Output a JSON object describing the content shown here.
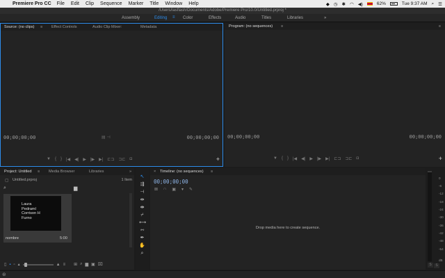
{
  "menubar": {
    "app_name": "Premiere Pro CC",
    "items": [
      "File",
      "Edit",
      "Clip",
      "Sequence",
      "Marker",
      "Title",
      "Window",
      "Help"
    ],
    "battery": "62%",
    "clock": "Tue 9:37 AM"
  },
  "titlebar": {
    "path": "/Users/lasflash/Documents/Adobe/Premiere Pro/10.0/Untitled.prproj *"
  },
  "workspaces": {
    "items": [
      "Assembly",
      "Editing",
      "Color",
      "Effects",
      "Audio",
      "Titles",
      "Libraries"
    ],
    "active": "Editing",
    "overflow": "»"
  },
  "source_panel": {
    "tabs": [
      "Source: (no clips)",
      "Effect Controls",
      "Audio Clip Mixer:",
      "Metadata"
    ],
    "tab_menu": "≡",
    "timecode_left": "00;00;00;00",
    "timecode_right": "00;00;00;00",
    "add_button": "+"
  },
  "program_panel": {
    "tab": "Program: (no sequences)",
    "tab_menu": "≡",
    "menu_icon": "≡",
    "timecode_left": "00;00;00;00",
    "timecode_right": "00;00;00;00",
    "add_button": "+"
  },
  "project_panel": {
    "tabs": [
      "Project: Untitled",
      "Media Browser",
      "Libraries"
    ],
    "tab_menu": "≡",
    "overflow": "»",
    "file_name": "Untitled.prproj",
    "item_count": "1 Item",
    "clip": {
      "thumb_lines": [
        "Laura",
        "Pedraml",
        "Corrison H",
        "Furno"
      ],
      "name": "nombre",
      "duration": "5:00"
    }
  },
  "timeline_panel": {
    "tab": "Timeline: (no sequences)",
    "close": "×",
    "tab_menu": "≡",
    "timecode": "00;00;00;00",
    "empty_message": "Drop media here to create sequence."
  },
  "audio_meter": {
    "scale": [
      "0",
      "-6",
      "-12",
      "-18",
      "-24",
      "-30",
      "-36",
      "-42",
      "-48",
      "-54",
      "dB"
    ],
    "solo_s1": "S",
    "solo_s2": "S"
  },
  "icons": {
    "apple": "apple-icon",
    "wifi": "wifi-icon",
    "search": "search-icon",
    "selection": "selection-tool-icon"
  },
  "colors": {
    "accent": "#2d8ceb",
    "panel": "#232323",
    "background": "#1c1c1c"
  }
}
